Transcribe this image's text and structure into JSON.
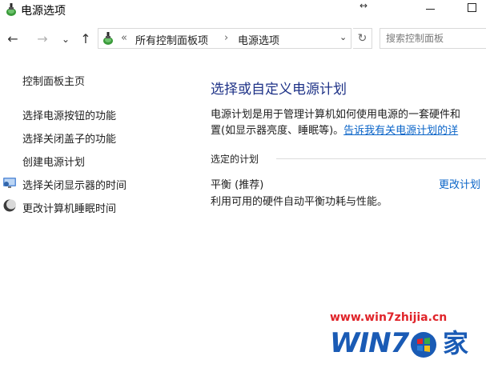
{
  "window": {
    "title": "电源选项"
  },
  "address_bar": {
    "overflow_marker": "«",
    "crumbs": [
      "所有控制面板项",
      "电源选项"
    ],
    "separator": "›",
    "search_placeholder": "搜索控制面板"
  },
  "nav": {
    "back": "←",
    "forward": "→",
    "recent": "⌄",
    "up": "↑",
    "refresh": "↻"
  },
  "left_pane": {
    "home_link": "控制面板主页",
    "links": [
      "选择电源按钮的功能",
      "选择关闭盖子的功能",
      "创建电源计划",
      "选择关闭显示器的时间",
      "更改计算机睡眠时间"
    ]
  },
  "main": {
    "heading": "选择或自定义电源计划",
    "description_line1": "电源计划是用于管理计算机如何使用电源的一套硬件和",
    "description_line2": "置(如显示器亮度、睡眠等)。",
    "help_link": "告诉我有关电源计划的详",
    "section_label": "选定的计划",
    "plan_name": "平衡 (推荐)",
    "plan_description": "利用可用的硬件自动平衡功耗与性能。",
    "change_plan_link": "更改计划"
  },
  "watermark": {
    "url": "www.win7zhijia.cn",
    "logo_text": "WIN7",
    "logo_char": "家"
  },
  "colors": {
    "heading": "#1e3287",
    "link": "#0a64c8",
    "watermark_red": "#e0242a",
    "watermark_blue": "#1a5bb5"
  }
}
